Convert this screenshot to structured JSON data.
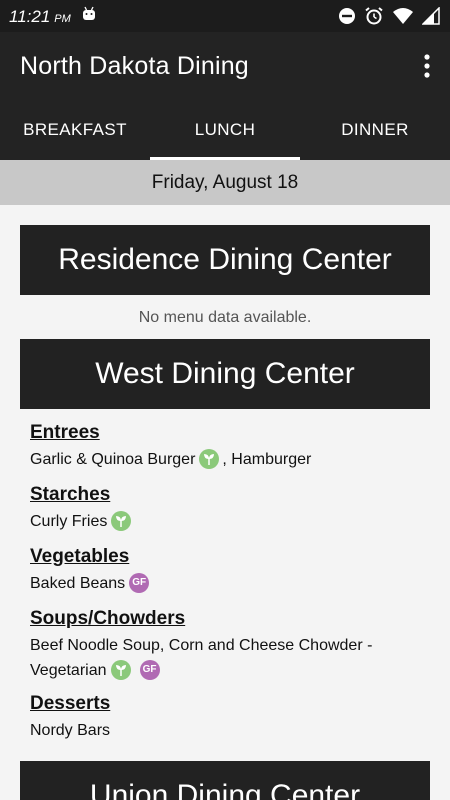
{
  "status": {
    "time": "11:21",
    "ampm": "PM"
  },
  "app": {
    "title": "North Dakota Dining"
  },
  "tabs": [
    {
      "label": "BREAKFAST"
    },
    {
      "label": "LUNCH"
    },
    {
      "label": "DINNER"
    }
  ],
  "date": "Friday, August 18",
  "halls": {
    "residence": {
      "name": "Residence Dining Center",
      "message": "No menu data available."
    },
    "west": {
      "name": "West Dining Center",
      "categories": [
        {
          "title": "Entrees",
          "item1": "Garlic & Quinoa Burger",
          "item2": ", Hamburger"
        },
        {
          "title": "Starches",
          "item1": "Curly Fries"
        },
        {
          "title": "Vegetables",
          "item1": "Baked Beans"
        },
        {
          "title": "Soups/Chowders",
          "line1": "Beef Noodle Soup, Corn and Cheese Chowder -",
          "line2": "Vegetarian"
        },
        {
          "title": "Desserts",
          "item1": "Nordy Bars"
        }
      ]
    },
    "union": {
      "name": "Union Dining Center"
    }
  },
  "badges": {
    "gf_label": "GF"
  },
  "colors": {
    "veg_badge": "#8bc97a",
    "gf_badge": "#b06ab3",
    "bar": "#232323"
  }
}
